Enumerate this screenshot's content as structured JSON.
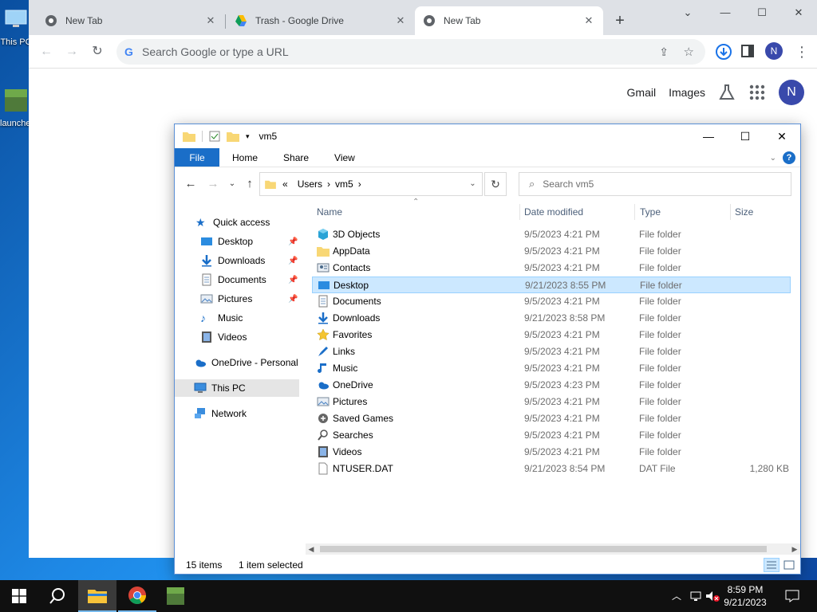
{
  "desktop": {
    "icons": [
      {
        "label": "This PC",
        "icon": "this-pc-icon"
      },
      {
        "label": "launcher",
        "icon": "game-launcher-icon"
      }
    ]
  },
  "chrome": {
    "tabs": [
      {
        "title": "New Tab",
        "favicon": "chrome-icon",
        "active": false
      },
      {
        "title": "Trash - Google Drive",
        "favicon": "google-drive-icon",
        "active": false
      },
      {
        "title": "New Tab",
        "favicon": "chrome-icon",
        "active": true
      }
    ],
    "omnibox_placeholder": "Search Google or type a URL",
    "profile_initial": "N",
    "ntp_links": {
      "gmail": "Gmail",
      "images": "Images"
    }
  },
  "explorer": {
    "title": "vm5",
    "ribbon_tabs": [
      "File",
      "Home",
      "Share",
      "View"
    ],
    "breadcrumb": [
      "Users",
      "vm5"
    ],
    "search_placeholder": "Search vm5",
    "nav_pane": {
      "quick_access": "Quick access",
      "quick_items": [
        "Desktop",
        "Downloads",
        "Documents",
        "Pictures",
        "Music",
        "Videos"
      ],
      "onedrive": "OneDrive - Personal",
      "this_pc": "This PC",
      "network": "Network"
    },
    "columns": {
      "name": "Name",
      "date": "Date modified",
      "type": "Type",
      "size": "Size"
    },
    "files": [
      {
        "name": "3D Objects",
        "date": "9/5/2023 4:21 PM",
        "type": "File folder",
        "size": "",
        "icon": "3d-objects-icon"
      },
      {
        "name": "AppData",
        "date": "9/5/2023 4:21 PM",
        "type": "File folder",
        "size": "",
        "icon": "folder-icon"
      },
      {
        "name": "Contacts",
        "date": "9/5/2023 4:21 PM",
        "type": "File folder",
        "size": "",
        "icon": "contacts-icon"
      },
      {
        "name": "Desktop",
        "date": "9/21/2023 8:55 PM",
        "type": "File folder",
        "size": "",
        "icon": "desktop-folder-icon"
      },
      {
        "name": "Documents",
        "date": "9/5/2023 4:21 PM",
        "type": "File folder",
        "size": "",
        "icon": "documents-icon"
      },
      {
        "name": "Downloads",
        "date": "9/21/2023 8:58 PM",
        "type": "File folder",
        "size": "",
        "icon": "downloads-icon"
      },
      {
        "name": "Favorites",
        "date": "9/5/2023 4:21 PM",
        "type": "File folder",
        "size": "",
        "icon": "favorites-icon"
      },
      {
        "name": "Links",
        "date": "9/5/2023 4:21 PM",
        "type": "File folder",
        "size": "",
        "icon": "links-icon"
      },
      {
        "name": "Music",
        "date": "9/5/2023 4:21 PM",
        "type": "File folder",
        "size": "",
        "icon": "music-icon"
      },
      {
        "name": "OneDrive",
        "date": "9/5/2023 4:23 PM",
        "type": "File folder",
        "size": "",
        "icon": "onedrive-icon"
      },
      {
        "name": "Pictures",
        "date": "9/5/2023 4:21 PM",
        "type": "File folder",
        "size": "",
        "icon": "pictures-icon"
      },
      {
        "name": "Saved Games",
        "date": "9/5/2023 4:21 PM",
        "type": "File folder",
        "size": "",
        "icon": "saved-games-icon"
      },
      {
        "name": "Searches",
        "date": "9/5/2023 4:21 PM",
        "type": "File folder",
        "size": "",
        "icon": "searches-icon"
      },
      {
        "name": "Videos",
        "date": "9/5/2023 4:21 PM",
        "type": "File folder",
        "size": "",
        "icon": "videos-icon"
      },
      {
        "name": "NTUSER.DAT",
        "date": "9/21/2023 8:54 PM",
        "type": "DAT File",
        "size": "1,280 KB",
        "icon": "file-icon"
      }
    ],
    "selected_index": 3,
    "status": {
      "count": "15 items",
      "selection": "1 item selected"
    }
  },
  "taskbar": {
    "time": "8:59 PM",
    "date": "9/21/2023"
  },
  "colors": {
    "accent": "#1a6ec8",
    "selection": "#cce8ff",
    "taskbar": "#101010"
  }
}
